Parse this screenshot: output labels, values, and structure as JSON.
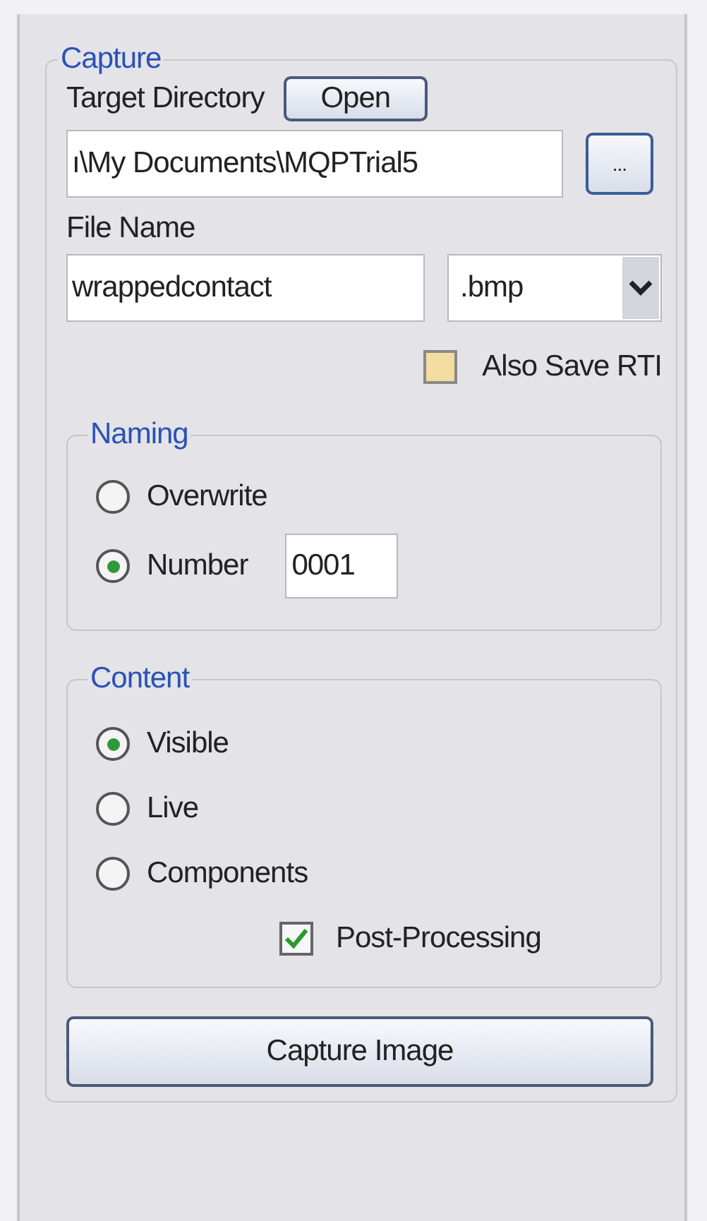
{
  "capture": {
    "title": "Capture",
    "target_directory_label": "Target Directory",
    "open_button": "Open",
    "directory_value": "ı\\My Documents\\MQPTrial5",
    "browse_button": "...",
    "file_name_label": "File Name",
    "file_name_value": "wrappedcontact",
    "extension": ".bmp",
    "also_save_rti": {
      "label": "Also Save RTI",
      "checked": false
    },
    "naming": {
      "title": "Naming",
      "options": [
        {
          "label": "Overwrite",
          "selected": false
        },
        {
          "label": "Number",
          "selected": true,
          "value": "0001"
        }
      ]
    },
    "content": {
      "title": "Content",
      "options": [
        {
          "label": "Visible",
          "selected": true
        },
        {
          "label": "Live",
          "selected": false
        },
        {
          "label": "Components",
          "selected": false
        }
      ],
      "post_processing": {
        "label": "Post-Processing",
        "checked": true
      }
    },
    "capture_button": "Capture Image"
  }
}
